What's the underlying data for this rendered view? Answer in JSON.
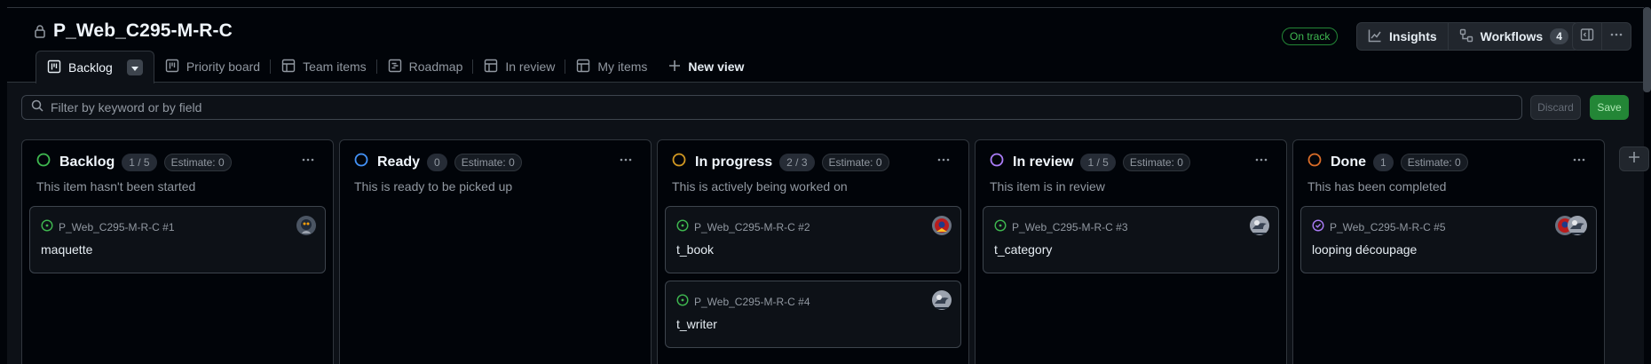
{
  "project": {
    "title": "P_Web_C295-M-R-C",
    "status": "On track"
  },
  "header_buttons": {
    "insights": "Insights",
    "workflows": "Workflows",
    "workflows_count": "4"
  },
  "tabs": [
    {
      "label": "Backlog",
      "icon": "board-icon",
      "active": true
    },
    {
      "label": "Priority board",
      "icon": "board-icon"
    },
    {
      "label": "Team items",
      "icon": "table-icon"
    },
    {
      "label": "Roadmap",
      "icon": "roadmap-icon"
    },
    {
      "label": "In review",
      "icon": "table-icon"
    },
    {
      "label": "My items",
      "icon": "table-icon"
    },
    {
      "label": "New view",
      "icon": "plus-icon"
    }
  ],
  "filter": {
    "placeholder": "Filter by keyword or by field",
    "discard": "Discard",
    "save": "Save"
  },
  "columns": [
    {
      "name": "Backlog",
      "count": "1 / 5",
      "estimate": "Estimate: 0",
      "description": "This item hasn't been started",
      "color": "#3fb950",
      "cards": [
        {
          "ref": "P_Web_C295-M-R-C #1",
          "title": "maquette",
          "state": "open"
        }
      ]
    },
    {
      "name": "Ready",
      "count": "0",
      "estimate": "Estimate: 0",
      "description": "This is ready to be picked up",
      "color": "#4493f8",
      "cards": []
    },
    {
      "name": "In progress",
      "count": "2 / 3",
      "estimate": "Estimate: 0",
      "description": "This is actively being worked on",
      "color": "#d29922",
      "cards": [
        {
          "ref": "P_Web_C295-M-R-C #2",
          "title": "t_book",
          "state": "open"
        },
        {
          "ref": "P_Web_C295-M-R-C #4",
          "title": "t_writer",
          "state": "open"
        }
      ]
    },
    {
      "name": "In review",
      "count": "1 / 5",
      "estimate": "Estimate: 0",
      "description": "This item is in review",
      "color": "#ab7df8",
      "cards": [
        {
          "ref": "P_Web_C295-M-R-C #3",
          "title": "t_category",
          "state": "open"
        }
      ]
    },
    {
      "name": "Done",
      "count": "1",
      "estimate": "Estimate: 0",
      "description": "This has been completed",
      "color": "#db6d28",
      "cards": [
        {
          "ref": "P_Web_C295-M-R-C #5",
          "title": "looping découpage",
          "state": "closed"
        }
      ]
    }
  ],
  "colors": {
    "open": "#3fb950",
    "closed": "#ab7df8",
    "accent": "#238636"
  }
}
